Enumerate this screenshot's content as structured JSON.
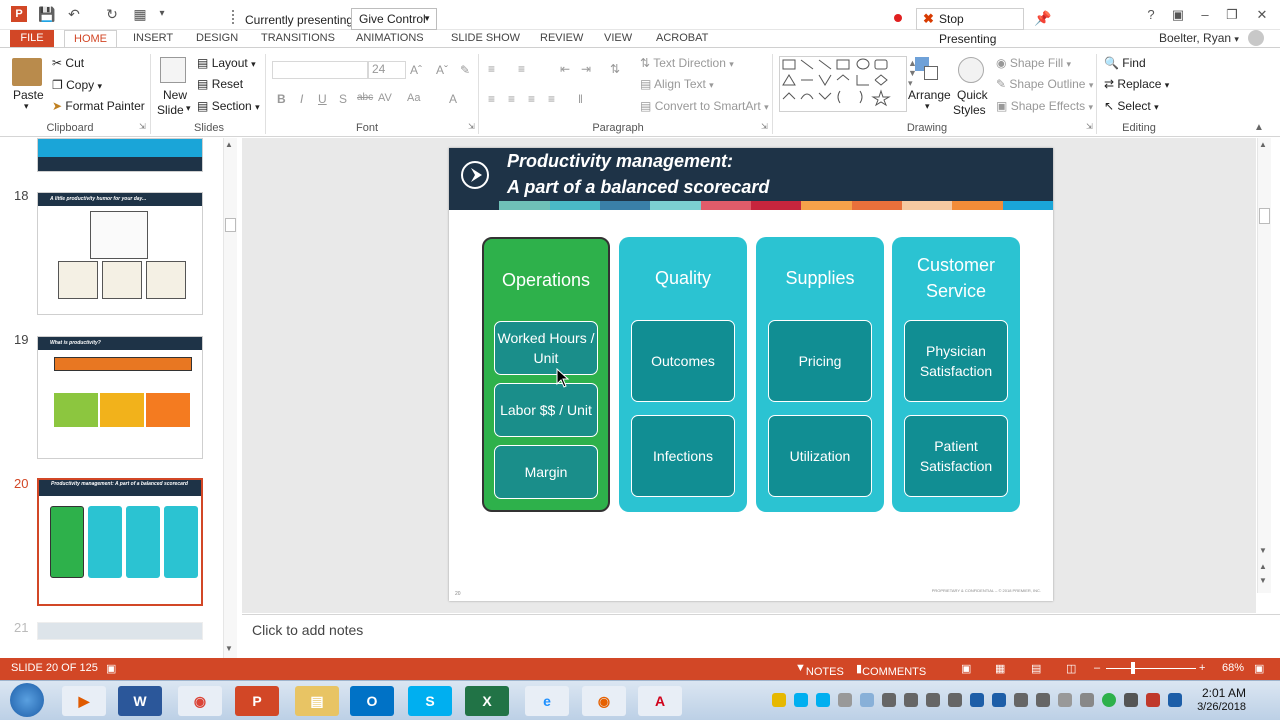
{
  "titlebar": {
    "currently_presenting": "Currently presenting",
    "give_control": "Give Control",
    "stop_presenting": "Stop Presenting"
  },
  "tabs": [
    "FILE",
    "HOME",
    "INSERT",
    "DESIGN",
    "TRANSITIONS",
    "ANIMATIONS",
    "SLIDE SHOW",
    "REVIEW",
    "VIEW",
    "ACROBAT"
  ],
  "user": "Boelter, Ryan",
  "ribbon": {
    "clipboard": {
      "paste": "Paste",
      "cut": "Cut",
      "copy": "Copy",
      "format_painter": "Format Painter",
      "label": "Clipboard"
    },
    "slides": {
      "new_slide_1": "New",
      "new_slide_2": "Slide",
      "layout": "Layout",
      "reset": "Reset",
      "section": "Section",
      "label": "Slides"
    },
    "font": {
      "size": "24",
      "label": "Font"
    },
    "paragraph": {
      "text_direction": "Text Direction",
      "align_text": "Align Text",
      "convert_smartart": "Convert to SmartArt",
      "label": "Paragraph"
    },
    "drawing": {
      "arrange": "Arrange",
      "quick_styles_1": "Quick",
      "quick_styles_2": "Styles",
      "shape_fill": "Shape Fill",
      "shape_outline": "Shape Outline",
      "shape_effects": "Shape Effects",
      "label": "Drawing"
    },
    "editing": {
      "find": "Find",
      "replace": "Replace",
      "select": "Select",
      "label": "Editing"
    }
  },
  "thumbnails": {
    "n18": "18",
    "n19": "19",
    "n20": "20",
    "n21": "21",
    "t18": "A little productivity humor for your day...",
    "t19": "What is productivity?",
    "t20": "Productivity management: A part of a balanced scorecard"
  },
  "slide": {
    "title_line1": "Productivity management:",
    "title_line2": "A part of a balanced scorecard",
    "number": "20",
    "confidential": "PROPRIETARY & CONFIDENTIAL – © 2018 PREMIER, INC.",
    "strip_colors": [
      "#1e3347",
      "#6fc1b8",
      "#4ab9c7",
      "#3a7fa8",
      "#7ccfd1",
      "#e05c6a",
      "#c7253d",
      "#f6a24a",
      "#e9703b",
      "#f5c9a1",
      "#f28c38",
      "#1aa5d8"
    ],
    "columns": [
      {
        "title": "Operations",
        "cards": [
          "Worked Hours / Unit",
          "Labor $$ / Unit",
          "Margin"
        ]
      },
      {
        "title": "Quality",
        "cards": [
          "Outcomes",
          "Infections"
        ]
      },
      {
        "title": "Supplies",
        "cards": [
          "Pricing",
          "Utilization"
        ]
      },
      {
        "title": "Customer Service",
        "cards": [
          "Physician Satisfaction",
          "Patient Satisfaction"
        ]
      }
    ]
  },
  "notes_placeholder": "Click to add notes",
  "status": {
    "slide_of": "SLIDE 20 OF 125",
    "notes": "NOTES",
    "comments": "COMMENTS",
    "zoom": "68%"
  },
  "taskbar": {
    "time": "2:01 AM",
    "date": "3/26/2018"
  }
}
